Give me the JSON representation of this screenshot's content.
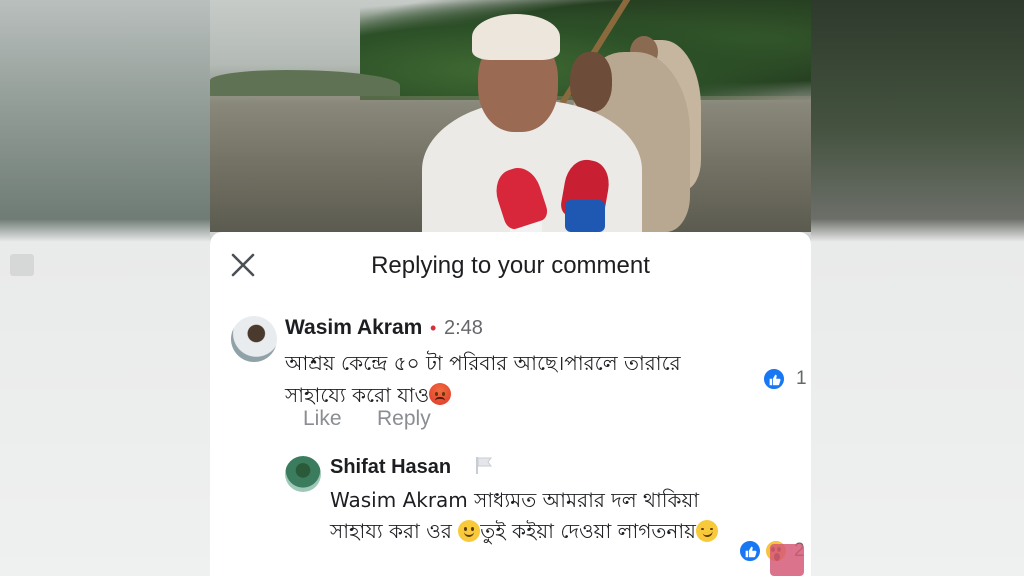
{
  "sheet": {
    "title": "Replying to your comment"
  },
  "comments": [
    {
      "author": "Wasim Akram",
      "separator": "•",
      "time": "2:48",
      "text": "আশ্রয় কেন্দ্রে ৫০ টা পরিবার আছে।পারলে তারারে সাহায্যে করো যাও",
      "emoji": "angry-face",
      "actions": {
        "like": "Like",
        "reply": "Reply"
      },
      "reactions": {
        "types": [
          "like"
        ],
        "count": "1"
      }
    },
    {
      "author": "Shifat Hasan",
      "text_part1": "Wasim Akram সাধ্যমত আমরার দল থাকিয়া সাহায্য করা ওর ",
      "text_part2": "তুই কইয়া দেওয়া লাগতনায়",
      "emojis": [
        "slightly-smiling-face",
        "smirking-face"
      ],
      "reactions": {
        "types": [
          "like",
          "wow"
        ],
        "count": "2"
      }
    }
  ],
  "colors": {
    "like_blue": "#1877f2",
    "text_primary": "#1c1e21",
    "text_secondary": "#65676b",
    "timestamp_dot": "#d3303a"
  }
}
